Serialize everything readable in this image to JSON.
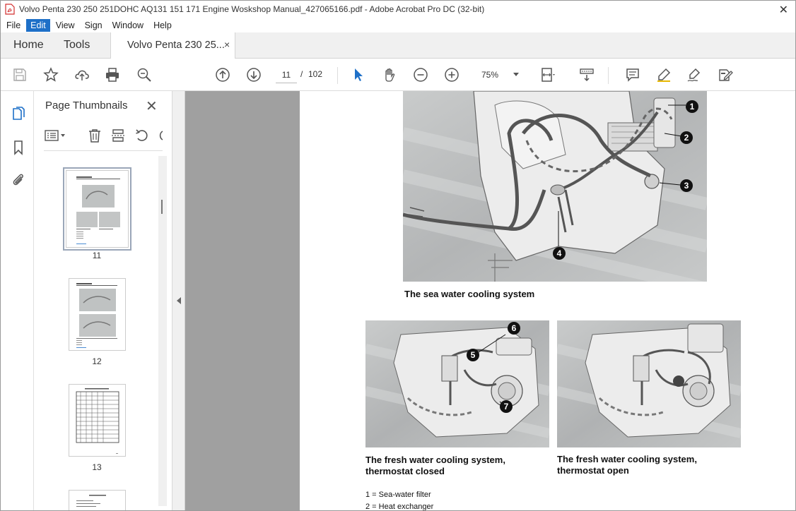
{
  "window": {
    "title": "Volvo Penta 230 250 251DOHC AQ131 151 171 Engine Woskshop Manual_427065166.pdf - Adobe Acrobat Pro DC (32-bit)",
    "close_glyph": "✕"
  },
  "menu": [
    "File",
    "Edit",
    "View",
    "Sign",
    "Window",
    "Help"
  ],
  "tabs": {
    "home": "Home",
    "tools": "Tools",
    "document": "Volvo Penta 230 25...",
    "close_glyph": "×"
  },
  "toolbar": {
    "current_page": "11",
    "page_separator": "/",
    "total_pages": "102",
    "zoom": "75%"
  },
  "thumbnails": {
    "title": "Page Thumbnails",
    "close_glyph": "✕",
    "pages": [
      "11",
      "12",
      "13"
    ],
    "selected_page": "11"
  },
  "document": {
    "fig1_caption": "The sea water cooling system",
    "fig2_caption_line1": "The fresh water cooling system,",
    "fig2_caption_line2": "thermostat closed",
    "fig3_caption_line1": "The fresh water cooling system,",
    "fig3_caption_line2": "thermostat open",
    "callouts": [
      "1",
      "2",
      "3",
      "4",
      "5",
      "6",
      "7"
    ],
    "legend": [
      "1 = Sea-water filter",
      "2 = Heat exchanger"
    ]
  }
}
